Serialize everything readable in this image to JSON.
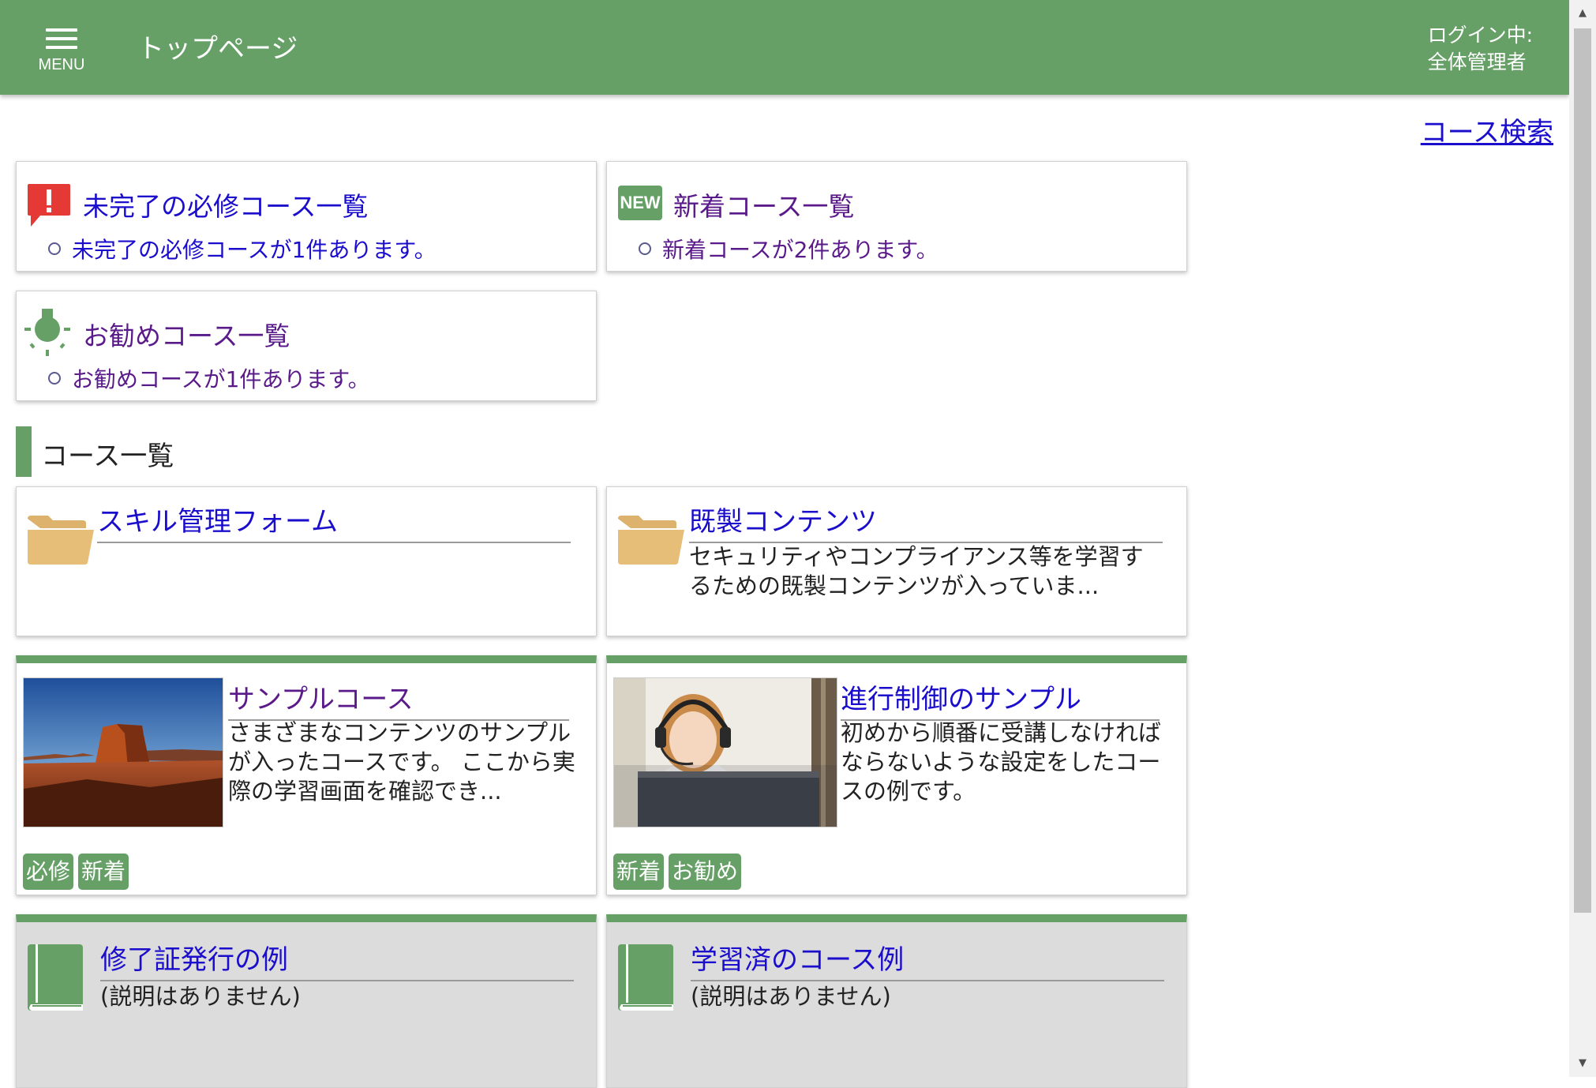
{
  "header": {
    "menu_label": "MENU",
    "page_title": "トップページ",
    "login_label": "ログイン中:",
    "user_name": "全体管理者"
  },
  "course_search": "コース検索",
  "info_cards": [
    {
      "title": "未完了の必修コース一覧",
      "item": "未完了の必修コースが1件あります。",
      "icon": "alert-icon"
    },
    {
      "title": "新着コース一覧",
      "item": "新着コースが2件あります。",
      "icon": "new-icon",
      "icon_text": "NEW"
    },
    {
      "title": "お勧めコース一覧",
      "item": "お勧めコースが1件あります。",
      "icon": "lightbulb-icon"
    }
  ],
  "section_title": "コース一覧",
  "folders": [
    {
      "title": "スキル管理フォーム",
      "desc": ""
    },
    {
      "title": "既製コンテンツ",
      "desc": "セキュリティやコンプライアンス等を学習するための既製コンテンツが入っていま..."
    }
  ],
  "courses": [
    {
      "title": "サンプルコース",
      "desc": "さまざまなコンテンツのサンプルが入ったコースです。 ここから実際の学習画面を確認でき...",
      "tags": [
        "必修",
        "新着"
      ],
      "image": "desert-mesa-photo"
    },
    {
      "title": "進行制御のサンプル",
      "desc": "初めから順番に受講しなければならないような設定をしたコースの例です。",
      "tags": [
        "新着",
        "お勧め"
      ],
      "image": "headset-woman-photo"
    }
  ],
  "completed_courses": [
    {
      "title": "修了証発行の例",
      "desc": "(説明はありません)"
    },
    {
      "title": "学習済のコース例",
      "desc": "(説明はありません)"
    }
  ],
  "colors": {
    "accent": "#66a067",
    "link": "#1a0dcc",
    "visited": "#5a1a8a",
    "alert": "#e53935",
    "folder": "#e6be78"
  }
}
